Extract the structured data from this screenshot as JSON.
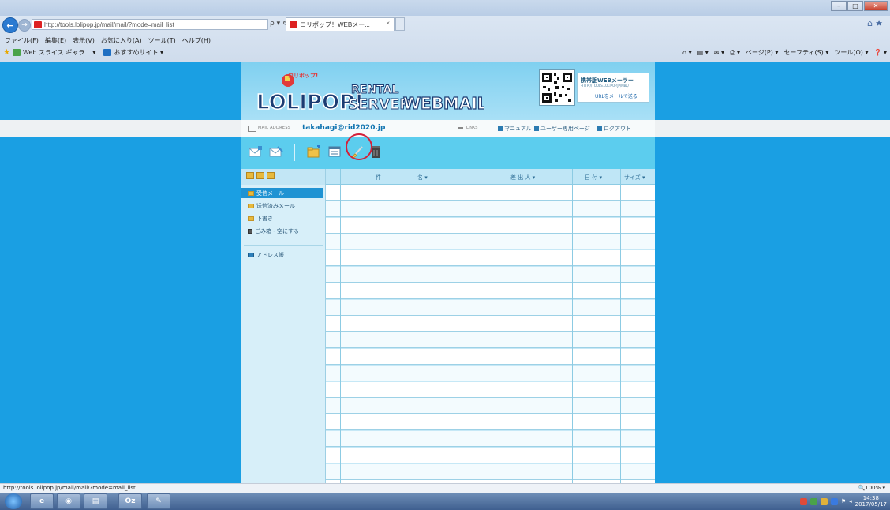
{
  "browser": {
    "url": "http://tools.lolipop.jp/mail/mail/?mode=mail_list",
    "addr_tools": "ρ ▾ ↻",
    "tab_title": "ロリポップ！WEBメー...",
    "tab_close": "×",
    "win_min": "–",
    "win_max": "□",
    "win_close": "✕",
    "home_star": "⌂★",
    "menu": [
      "ファイル(F)",
      "編集(E)",
      "表示(V)",
      "お気に入り(A)",
      "ツール(T)",
      "ヘルプ(H)"
    ],
    "favorites": [
      "Web スライス ギャラ... ▾",
      "おすすめサイト ▾"
    ],
    "commands": [
      "ページ(P) ▾",
      "セーフティ(S) ▾",
      "ツール(O) ▾"
    ]
  },
  "banner": {
    "logo_text": "LOLIPOP! RENTAL SERVER WEBMAILER",
    "qr_title": "携帯版WEBメーラー",
    "qr_url": "HTTP://TOOLS.LOLIPOP.JP/MBL/",
    "qr_link": "URLをメールで送る"
  },
  "info": {
    "mail_address_label": "MAIL ADDRESS",
    "email": "takahagi@rid2020.jp",
    "links_label": "LINKS",
    "links": [
      "マニュアル",
      "ユーザー専用ページ",
      "ログアウト"
    ]
  },
  "sidebar": {
    "folders": [
      "受信メール",
      "送信済みメール",
      "下書き",
      "ごみ箱 - 空にする",
      "アドレス帳"
    ]
  },
  "table": {
    "headers": [
      "件",
      "名 ▾",
      "差 出 人 ▾",
      "日 付 ▾",
      "サイズ ▾"
    ]
  },
  "status": {
    "url": "http://tools.lolipop.jp/mail/mail/?mode=mail_list",
    "zoom": "🔍100% ▾"
  },
  "taskbar": {
    "buttons": [
      "e",
      "◉",
      "▤",
      "Oz",
      "✎"
    ],
    "clock_time": "14:38",
    "clock_date": "2017/05/17"
  },
  "colors": {
    "page_bg": "#1a9fe3",
    "toolbar": "#5ccdee",
    "highlight": "#d3213a",
    "selected_folder": "#1f93d3"
  }
}
